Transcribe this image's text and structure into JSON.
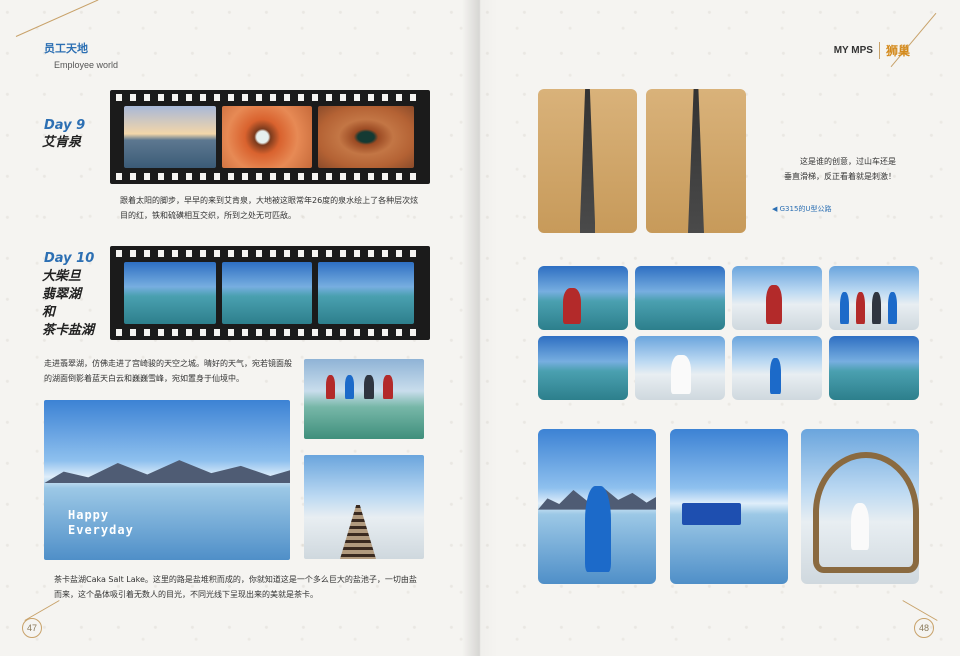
{
  "header_left": {
    "title_cn": "员工天地",
    "title_en": "Employee world"
  },
  "header_right": {
    "brand": "MY MPS",
    "section": "狮巢"
  },
  "day9": {
    "day": "Day 9",
    "place": "艾肯泉",
    "text": "跟着太阳的脚步，早早的来到艾肯泉，大地被这眼常年26度的泉水绘上了各种层次炫目的红，铁和硫磺相互交织，所到之处无可匹敌。"
  },
  "day10": {
    "day": "Day 10",
    "places": [
      "大柴旦",
      "翡翠湖",
      "和",
      "茶卡盐湖"
    ],
    "text": "走进翡翠湖，仿佛走进了宫崎骏的天空之城。晴好的天气，宛若镜面般的湖面倒影着蓝天白云和巍巍雪峰，宛如置身于仙境中。",
    "overlay": [
      "Happy",
      "Everyday"
    ],
    "salt_text": "茶卡盐湖Caka Salt Lake。这里的路是盐堆积而成的，你就知道这是一个多么巨大的盐池子，一切由盐而来，这个晶体吸引着无数人的目光，不同光线下呈现出来的美就是茶卡。"
  },
  "right_caption": {
    "lines": [
      "这是谁的创意，过山车还是",
      "垂直滑梯，反正看着就是刺激！"
    ],
    "tag": "◀ G315的U型公路"
  },
  "page_numbers": {
    "left": "47",
    "right": "48"
  },
  "colors": {
    "accent_blue": "#2c6fb3",
    "gold": "#c8a26a",
    "brand_orange": "#d48a1c"
  }
}
